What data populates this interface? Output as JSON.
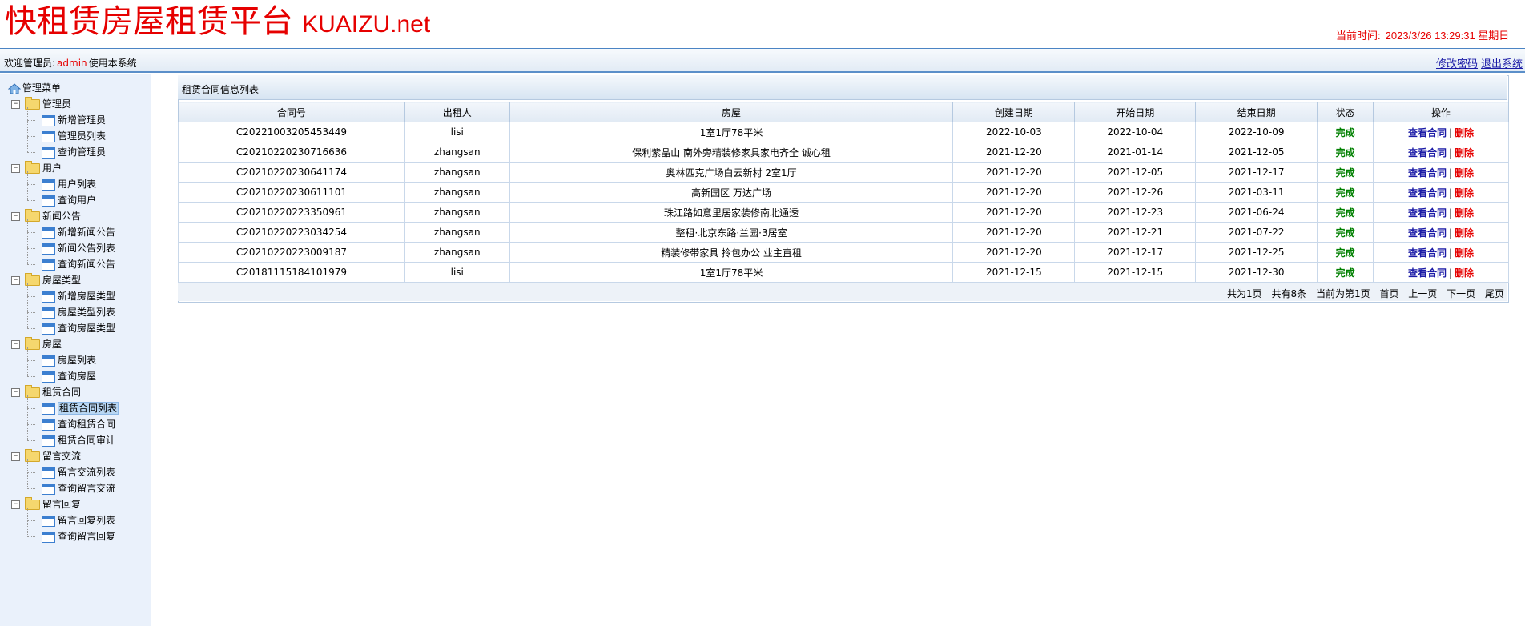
{
  "header": {
    "title_cn": "快租赁房屋租赁平台",
    "title_en": "KUAIZU.net",
    "time_label": "当前时间:",
    "time_value": "2023/3/26 13:29:31 星期日"
  },
  "welcome": {
    "prefix": "欢迎管理员:",
    "user": "admin",
    "suffix": "使用本系统"
  },
  "top_links": {
    "change_password": "修改密码",
    "logout": "退出系统"
  },
  "colors": {
    "brand_red": "#e60000",
    "status_green": "#008000",
    "link_blue": "#1a1aa6"
  },
  "sidebar": {
    "root": "管理菜单",
    "active": "租赁合同列表",
    "groups": [
      {
        "label": "管理员",
        "items": [
          "新增管理员",
          "管理员列表",
          "查询管理员"
        ]
      },
      {
        "label": "用户",
        "items": [
          "用户列表",
          "查询用户"
        ]
      },
      {
        "label": "新闻公告",
        "items": [
          "新增新闻公告",
          "新闻公告列表",
          "查询新闻公告"
        ]
      },
      {
        "label": "房屋类型",
        "items": [
          "新增房屋类型",
          "房屋类型列表",
          "查询房屋类型"
        ]
      },
      {
        "label": "房屋",
        "items": [
          "房屋列表",
          "查询房屋"
        ]
      },
      {
        "label": "租赁合同",
        "items": [
          "租赁合同列表",
          "查询租赁合同",
          "租赁合同审计"
        ]
      },
      {
        "label": "留言交流",
        "items": [
          "留言交流列表",
          "查询留言交流"
        ]
      },
      {
        "label": "留言回复",
        "items": [
          "留言回复列表",
          "查询留言回复"
        ]
      }
    ]
  },
  "panel": {
    "title": "租赁合同信息列表"
  },
  "table": {
    "columns": [
      "合同号",
      "出租人",
      "房屋",
      "创建日期",
      "开始日期",
      "结束日期",
      "状态",
      "操作"
    ],
    "rows": [
      {
        "contract": "C20221003205453449",
        "landlord": "lisi",
        "house": "1室1厅78平米",
        "created": "2022-10-03",
        "start": "2022-10-04",
        "end": "2022-10-09",
        "status": "完成"
      },
      {
        "contract": "C20210220230716636",
        "landlord": "zhangsan",
        "house": "保利紫晶山 南外旁精装修家具家电齐全 诚心租",
        "created": "2021-12-20",
        "start": "2021-01-14",
        "end": "2021-12-05",
        "status": "完成"
      },
      {
        "contract": "C20210220230641174",
        "landlord": "zhangsan",
        "house": "奥林匹克广场白云新村 2室1厅",
        "created": "2021-12-20",
        "start": "2021-12-05",
        "end": "2021-12-17",
        "status": "完成"
      },
      {
        "contract": "C20210220230611101",
        "landlord": "zhangsan",
        "house": "高新园区 万达广场",
        "created": "2021-12-20",
        "start": "2021-12-26",
        "end": "2021-03-11",
        "status": "完成"
      },
      {
        "contract": "C20210220223350961",
        "landlord": "zhangsan",
        "house": "珠江路如意里居家装修南北通透",
        "created": "2021-12-20",
        "start": "2021-12-23",
        "end": "2021-06-24",
        "status": "完成"
      },
      {
        "contract": "C20210220223034254",
        "landlord": "zhangsan",
        "house": "整租·北京东路·兰园·3居室",
        "created": "2021-12-20",
        "start": "2021-12-21",
        "end": "2021-07-22",
        "status": "完成"
      },
      {
        "contract": "C20210220223009187",
        "landlord": "zhangsan",
        "house": "精装修带家具 拎包办公 业主直租",
        "created": "2021-12-20",
        "start": "2021-12-17",
        "end": "2021-12-25",
        "status": "完成"
      },
      {
        "contract": "C20181115184101979",
        "landlord": "lisi",
        "house": "1室1厅78平米",
        "created": "2021-12-15",
        "start": "2021-12-15",
        "end": "2021-12-30",
        "status": "完成"
      }
    ],
    "actions": {
      "view": "查看合同",
      "separator": "|",
      "delete": "删除"
    }
  },
  "pager": {
    "total_pages": "共为1页",
    "total_records": "共有8条",
    "current_page": "当前为第1页",
    "first": "首页",
    "prev": "上一页",
    "next": "下一页",
    "last": "尾页"
  }
}
